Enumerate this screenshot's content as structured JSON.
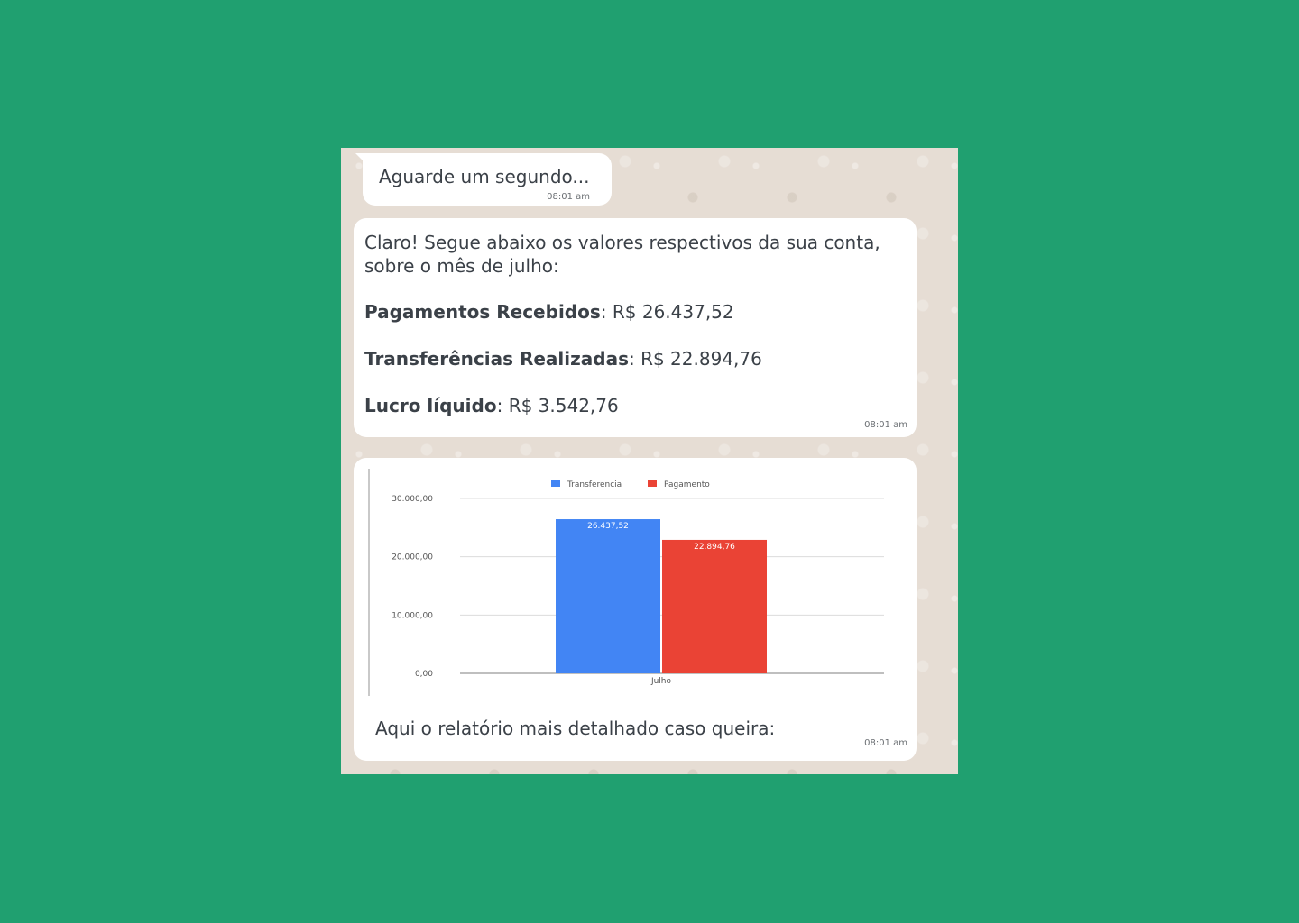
{
  "messages": {
    "first": {
      "text": "Aguarde um segundo...",
      "time": "08:01 am"
    },
    "second": {
      "intro": "Claro! Segue abaixo os valores respectivos da sua conta, sobre o mês de julho:",
      "items": [
        {
          "label": "Pagamentos Recebidos",
          "value": ": R$ 26.437,52"
        },
        {
          "label": "Transferências Realizadas",
          "value": ": R$ 22.894,76"
        },
        {
          "label": "Lucro líquido",
          "value": ": R$ 3.542,76"
        }
      ],
      "time": "08:01 am"
    },
    "third": {
      "caption": "Aqui o relatório mais detalhado caso queira:",
      "time": "08:01 am"
    }
  },
  "chart_data": {
    "type": "bar",
    "categories": [
      "Julho"
    ],
    "series": [
      {
        "name": "Transferencia",
        "values": [
          26437.52
        ],
        "label": "26.437,52",
        "color": "#4285f4"
      },
      {
        "name": "Pagamento",
        "values": [
          22894.76
        ],
        "label": "22.894,76",
        "color": "#ea4335"
      }
    ],
    "yticks": [
      0,
      10000,
      20000,
      30000
    ],
    "ytick_labels": [
      "0,00",
      "10.000,00",
      "20.000,00",
      "30.000,00"
    ],
    "ylim": [
      0,
      30000
    ],
    "grid": true,
    "legend": "top-center"
  }
}
